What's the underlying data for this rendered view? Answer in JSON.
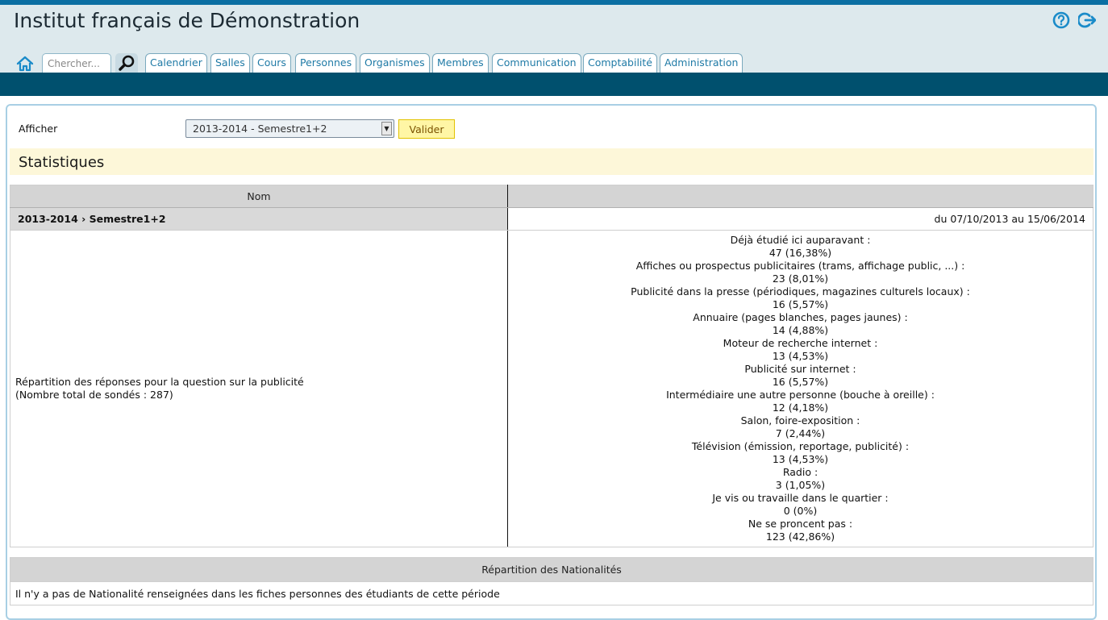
{
  "header": {
    "title": "Institut français de Démonstration",
    "search_placeholder": "Chercher...",
    "tabs": [
      "Calendrier",
      "Salles",
      "Cours",
      "Personnes",
      "Organismes",
      "Membres",
      "Communication",
      "Comptabilité",
      "Administration"
    ],
    "icons": {
      "home": "home-icon",
      "search": "magnifier-icon",
      "help": "help-icon",
      "logout": "logout-icon"
    },
    "colors": {
      "accent": "#1f7aa6",
      "navbar": "#00506e",
      "header_bg": "#dde9ed"
    }
  },
  "filter": {
    "label": "Afficher",
    "selected": "2013-2014 - Semestre1+2",
    "button": "Valider"
  },
  "section": {
    "title": "Statistiques"
  },
  "stats_table": {
    "col_name": "Nom",
    "col_value": "",
    "period_name": "2013-2014 › Semestre1+2",
    "period_dates": "du 07/10/2013 au 15/06/2014",
    "question_label": "Répartition des réponses pour la question sur la publicité",
    "question_total": "(Nombre total de sondés : 287)",
    "answers": [
      {
        "label": "Déjà étudié ici auparavant :",
        "value": "47 (16,38%)"
      },
      {
        "label": "Affiches ou prospectus publicitaires (trams, affichage public, ...) :",
        "value": "23 (8,01%)"
      },
      {
        "label": "Publicité dans la presse (périodiques, magazines culturels locaux) :",
        "value": "16 (5,57%)"
      },
      {
        "label": "Annuaire (pages blanches, pages jaunes) :",
        "value": "14 (4,88%)"
      },
      {
        "label": "Moteur de recherche internet :",
        "value": "13 (4,53%)"
      },
      {
        "label": "Publicité sur internet :",
        "value": "16 (5,57%)"
      },
      {
        "label": "Intermédiaire une autre personne (bouche à oreille) :",
        "value": "12 (4,18%)"
      },
      {
        "label": "Salon, foire-exposition :",
        "value": "7 (2,44%)"
      },
      {
        "label": "Télévision (émission, reportage, publicité) :",
        "value": "13 (4,53%)"
      },
      {
        "label": "Radio :",
        "value": "3 (1,05%)"
      },
      {
        "label": "Je vis ou travaille dans le quartier :",
        "value": "0 (0%)"
      },
      {
        "label": "Ne se proncent pas :",
        "value": "123 (42,86%)"
      }
    ]
  },
  "nationalities": {
    "heading": "Répartition des Nationalités",
    "message": "Il n'y a pas de Nationalité renseignées dans les fiches personnes des étudiants de cette période"
  }
}
